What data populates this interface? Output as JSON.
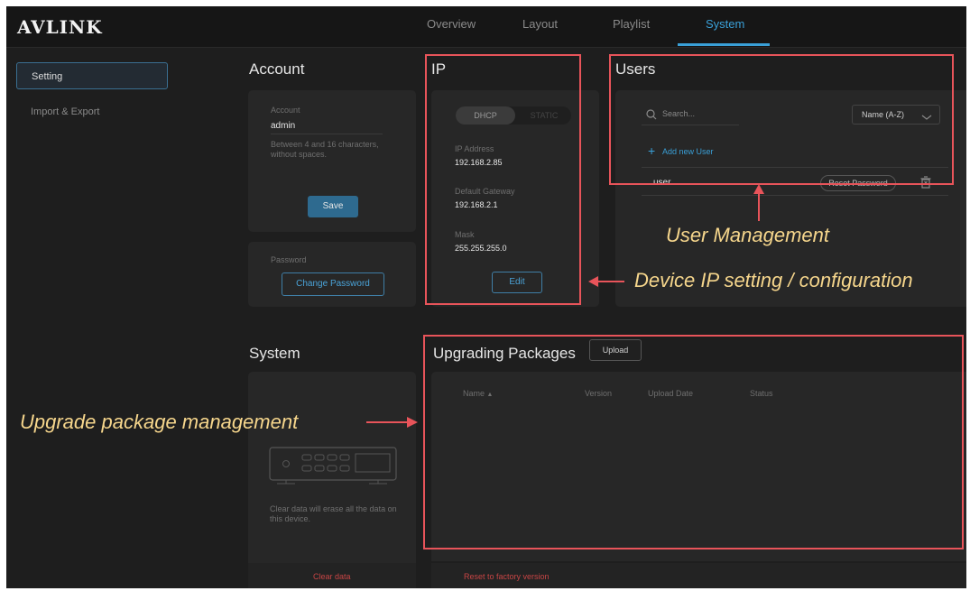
{
  "app": {
    "logo": "AVLINK"
  },
  "nav": {
    "tabs": [
      {
        "label": "Overview"
      },
      {
        "label": "Layout"
      },
      {
        "label": "Playlist"
      },
      {
        "label": "System"
      }
    ],
    "active_tab": "System"
  },
  "sidebar": {
    "items": [
      {
        "label": "Setting"
      },
      {
        "label": "Import & Export"
      }
    ]
  },
  "account": {
    "title": "Account",
    "field_label": "Account",
    "value": "admin",
    "hint": "Between 4 and 16 characters, without spaces.",
    "save_label": "Save",
    "password_label": "Password",
    "change_password_label": "Change Password"
  },
  "ip": {
    "title": "IP",
    "mode_dhcp": "DHCP",
    "mode_static": "STATIC",
    "address_label": "IP Address",
    "address_value": "192.168.2.85",
    "gateway_label": "Default Gateway",
    "gateway_value": "192.168.2.1",
    "mask_label": "Mask",
    "mask_value": "255.255.255.0",
    "edit_label": "Edit"
  },
  "users": {
    "title": "Users",
    "search_placeholder": "Search...",
    "sort_value": "Name (A-Z)",
    "add_label": "Add new User",
    "rows": [
      {
        "name": "user",
        "reset_label": "Reset Password"
      }
    ]
  },
  "system": {
    "title": "System",
    "clear_hint": "Clear data will erase all the data on this device.",
    "clear_label": "Clear data"
  },
  "packages": {
    "title": "Upgrading Packages",
    "upload_label": "Upload",
    "columns": [
      "Name",
      "Version",
      "Upload Date",
      "Status"
    ],
    "reset_label": "Reset to factory version"
  },
  "annotations": {
    "user_management": "User Management",
    "ip_setting": "Device IP setting / configuration",
    "upgrade_mgmt": "Upgrade package management"
  },
  "colors": {
    "accent": "#3aa0d8",
    "annotation_box": "#e8545a",
    "annotation_text": "#f6d68c",
    "danger": "#c84545"
  }
}
